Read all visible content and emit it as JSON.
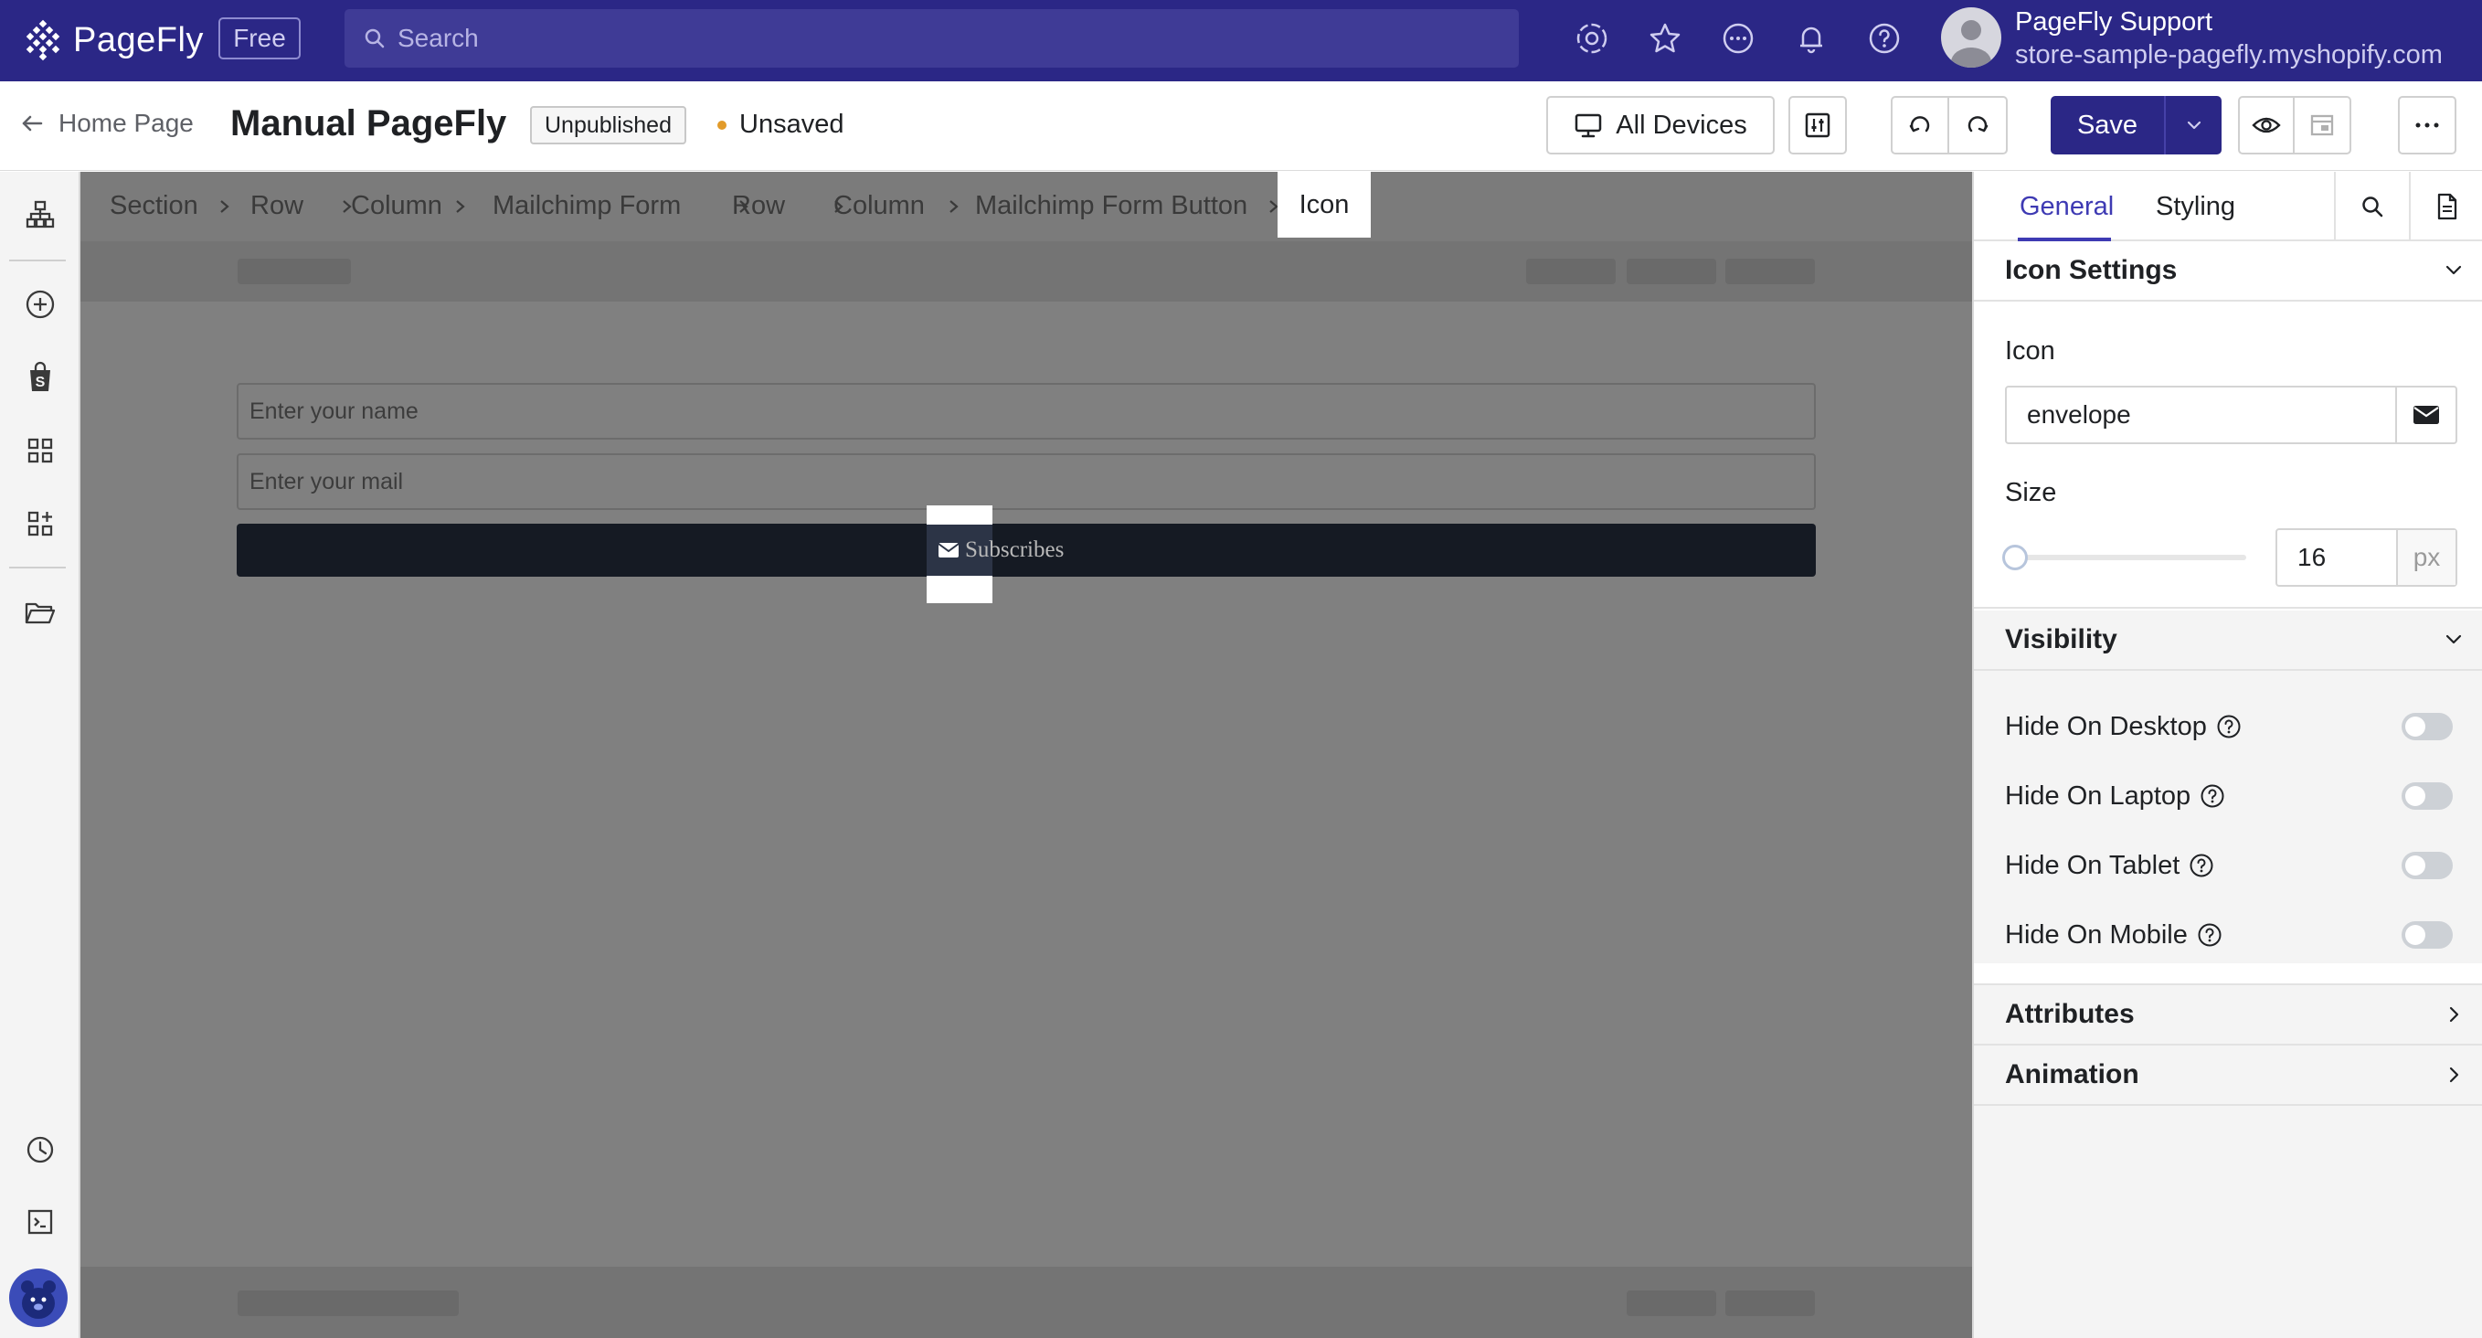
{
  "topbar": {
    "logo_text": "PageFly",
    "plan_badge": "Free",
    "search_placeholder": "Search",
    "icons": [
      "integration-icon",
      "star-icon",
      "chat-icon",
      "bell-icon",
      "help-icon"
    ],
    "user": {
      "name": "PageFly Support",
      "store": "store-sample-pagefly.myshopify.com"
    }
  },
  "subbar": {
    "back_label": "Home Page",
    "page_title": "Manual PageFly",
    "status": "Unpublished",
    "save_state": "Unsaved",
    "device_label": "All Devices",
    "save_label": "Save"
  },
  "rail": {
    "icons": [
      "sitemap-icon",
      "add-element-icon",
      "shopify-icon",
      "grid-icon",
      "layout-icon",
      "folder-icon",
      "history-icon",
      "terminal-icon",
      "bear-avatar-icon"
    ]
  },
  "breadcrumbs": [
    "Section",
    "Row",
    "Column",
    "Mailchimp Form",
    "Row",
    "Column",
    "Mailchimp Form Button",
    "Icon"
  ],
  "canvas": {
    "name_placeholder": "Enter your name",
    "mail_placeholder": "Enter your mail",
    "button_label": "Subscribes"
  },
  "panel": {
    "tabs": [
      "General",
      "Styling"
    ],
    "active_tab": "General",
    "icon_settings": {
      "title": "Icon Settings",
      "icon_label": "Icon",
      "icon_value": "envelope",
      "size_label": "Size",
      "size_value": "16",
      "size_unit": "px",
      "size_slider_fraction": 0.0
    },
    "visibility": {
      "title": "Visibility",
      "rows": [
        {
          "label": "Hide On Desktop",
          "on": false
        },
        {
          "label": "Hide On Laptop",
          "on": false
        },
        {
          "label": "Hide On Tablet",
          "on": false
        },
        {
          "label": "Hide On Mobile",
          "on": false
        }
      ]
    },
    "attributes_title": "Attributes",
    "animation_title": "Animation"
  },
  "colors": {
    "brand": "#2b2786",
    "accent": "#3e3ab3",
    "unsaved_dot": "#e29b2a"
  }
}
